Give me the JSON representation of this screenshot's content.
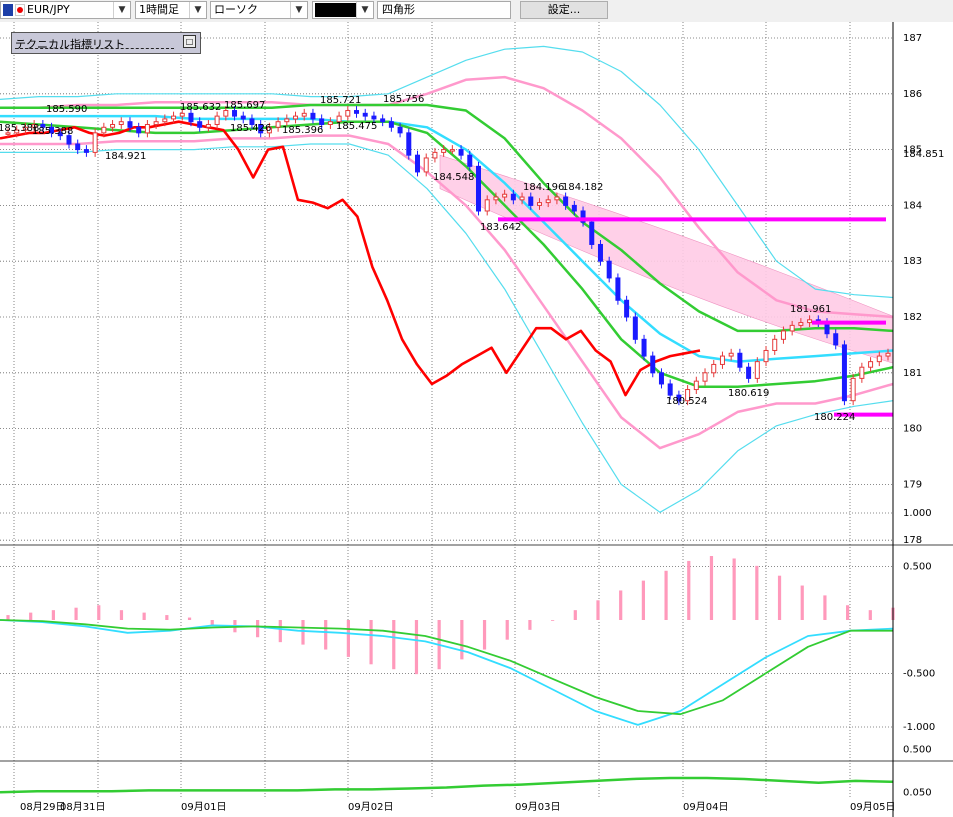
{
  "toolbar": {
    "symbol": "EUR/JPY",
    "timeframe": "1時間足",
    "chart_type": "ローソク",
    "drawing_tool_value": "",
    "shape_label": "四角形",
    "settings_label": "設定..."
  },
  "indicator_panel": {
    "title": "テクニカル指標リスト"
  },
  "colors": {
    "bull": "#e53939",
    "bear": "#1a1aff",
    "rsi": "#ff0000",
    "bb_outer": "#55ddee",
    "bb_inner": "#ff99cc",
    "ma_green": "#33cc33",
    "ma_cyan": "#33ddff",
    "cloud": "#ffcce6",
    "hline": "#ff00ff"
  },
  "chart_data": [
    {
      "type": "line",
      "name": "price",
      "y_ticks": [
        "187",
        "186",
        "185",
        "184",
        "183",
        "182",
        "181",
        "180",
        "179",
        "178"
      ],
      "ylim": [
        177.8,
        187.3
      ],
      "current_price": "184.851",
      "x_date_labels": [
        "08月29日",
        "08月31日",
        "09月01日",
        "09月02日",
        "09月03日",
        "09月04日",
        "09月05日"
      ],
      "annotations": [
        "185.388",
        "185.590",
        "184.921",
        "185.632",
        "185.697",
        "185.426",
        "185.396",
        "185.721",
        "185.475",
        "185.756",
        "184.548",
        "184.196",
        "184.182",
        "183.642",
        "180.524",
        "180.619",
        "181.961",
        "180.224"
      ],
      "candles_close": [
        185.3,
        185.35,
        185.4,
        185.45,
        185.4,
        185.3,
        185.25,
        185.1,
        185.0,
        184.95,
        185.3,
        185.4,
        185.45,
        185.5,
        185.4,
        185.3,
        185.45,
        185.5,
        185.55,
        185.6,
        185.65,
        185.5,
        185.4,
        185.45,
        185.6,
        185.7,
        185.6,
        185.55,
        185.45,
        185.3,
        185.4,
        185.5,
        185.55,
        185.6,
        185.65,
        185.55,
        185.45,
        185.5,
        185.6,
        185.7,
        185.65,
        185.6,
        185.55,
        185.5,
        185.4,
        185.3,
        184.9,
        184.6,
        184.85,
        184.95,
        185.0,
        185.0,
        184.9,
        184.7,
        183.9,
        184.1,
        184.15,
        184.2,
        184.1,
        184.15,
        184.0,
        184.05,
        184.1,
        184.15,
        184.0,
        183.9,
        183.7,
        183.3,
        183.0,
        182.7,
        182.3,
        182.0,
        181.6,
        181.3,
        181.0,
        180.8,
        180.6,
        180.5,
        180.7,
        180.85,
        181.0,
        181.15,
        181.3,
        181.35,
        181.1,
        180.9,
        181.2,
        181.4,
        181.6,
        181.75,
        181.85,
        181.9,
        181.95,
        181.9,
        181.7,
        181.5,
        180.5,
        180.9,
        181.1,
        181.2,
        181.3,
        181.35
      ],
      "bb_upper2": [
        185.9,
        185.95,
        185.95,
        186.0,
        186.0,
        186.0,
        186.0,
        186.0,
        185.95,
        185.95,
        186.0,
        186.3,
        186.6,
        186.8,
        186.85,
        186.75,
        186.4,
        185.8,
        185.0,
        184.0,
        183.0,
        182.5,
        182.4,
        182.35
      ],
      "bb_upper1": [
        185.75,
        185.75,
        185.8,
        185.8,
        185.85,
        185.85,
        185.85,
        185.85,
        185.8,
        185.8,
        185.8,
        186.0,
        186.25,
        186.3,
        186.1,
        185.7,
        185.2,
        184.5,
        183.6,
        182.8,
        182.3,
        182.1,
        182.05,
        182.0
      ],
      "bb_lower1": [
        185.1,
        185.1,
        185.1,
        185.15,
        185.15,
        185.15,
        185.2,
        185.2,
        185.25,
        185.25,
        185.1,
        184.6,
        184.0,
        183.2,
        182.2,
        181.2,
        180.2,
        179.65,
        179.9,
        180.3,
        180.45,
        180.45,
        180.6,
        180.8
      ],
      "bb_lower2": [
        184.95,
        184.95,
        184.95,
        185.0,
        185.0,
        185.0,
        185.05,
        185.05,
        185.1,
        185.1,
        184.9,
        184.3,
        183.5,
        182.5,
        181.3,
        180.1,
        179.0,
        178.5,
        178.9,
        179.6,
        180.05,
        180.25,
        180.4,
        180.5
      ],
      "ma_green_a": [
        185.75,
        185.75,
        185.75,
        185.75,
        185.75,
        185.75,
        185.75,
        185.75,
        185.8,
        185.8,
        185.8,
        185.8,
        185.7,
        185.2,
        184.4,
        183.7,
        183.2,
        182.6,
        182.1,
        181.75,
        181.75,
        181.8,
        181.8,
        181.75
      ],
      "ma_green_b": [
        185.5,
        185.45,
        185.4,
        185.35,
        185.3,
        185.3,
        185.35,
        185.4,
        185.45,
        185.5,
        185.5,
        185.3,
        184.7,
        184.0,
        183.3,
        182.5,
        181.6,
        181.0,
        180.75,
        180.75,
        180.8,
        180.85,
        180.95,
        181.1
      ],
      "ma_cyan": [
        185.6,
        185.6,
        185.6,
        185.6,
        185.6,
        185.55,
        185.55,
        185.55,
        185.55,
        185.5,
        185.5,
        185.4,
        185.0,
        184.4,
        183.7,
        183.0,
        182.3,
        181.7,
        181.3,
        181.2,
        181.25,
        181.3,
        181.35,
        181.4
      ],
      "rsi_overlay": [
        185.2,
        185.25,
        185.3,
        185.3,
        185.35,
        185.4,
        185.3,
        185.25,
        185.3,
        185.4,
        185.4,
        185.45,
        185.5,
        185.45,
        185.4,
        185.35,
        185.0,
        184.5,
        185.0,
        185.05,
        184.1,
        184.05,
        183.95,
        184.1,
        183.8,
        182.9,
        182.3,
        181.6,
        181.15,
        180.8,
        180.95,
        181.15,
        181.3,
        181.45,
        181.0,
        181.4,
        181.8,
        181.8,
        181.6,
        181.75,
        181.4,
        181.2,
        180.6,
        181.05,
        181.2,
        181.3,
        181.35,
        181.4
      ]
    },
    {
      "type": "line",
      "name": "macd",
      "y_ticks": [
        "1.000",
        "0.500",
        "-0.500",
        "-1.000"
      ],
      "ylim": [
        -1.1,
        1.1
      ],
      "histogram": [
        0.02,
        0.03,
        0.04,
        0.05,
        0.06,
        0.04,
        0.03,
        0.02,
        0.01,
        -0.02,
        -0.05,
        -0.07,
        -0.09,
        -0.1,
        -0.12,
        -0.15,
        -0.18,
        -0.2,
        -0.22,
        -0.2,
        -0.16,
        -0.12,
        -0.08,
        -0.04,
        0.0,
        0.04,
        0.08,
        0.12,
        0.16,
        0.2,
        0.24,
        0.26,
        0.25,
        0.22,
        0.18,
        0.14,
        0.1,
        0.06,
        0.04,
        0.05
      ],
      "macd_line": [
        0.0,
        -0.02,
        -0.06,
        -0.12,
        -0.1,
        -0.05,
        -0.06,
        -0.1,
        -0.12,
        -0.15,
        -0.2,
        -0.3,
        -0.45,
        -0.65,
        -0.85,
        -0.98,
        -0.85,
        -0.6,
        -0.35,
        -0.15,
        -0.1,
        -0.08
      ],
      "signal_line": [
        0.0,
        -0.01,
        -0.04,
        -0.08,
        -0.09,
        -0.07,
        -0.06,
        -0.07,
        -0.08,
        -0.1,
        -0.15,
        -0.25,
        -0.38,
        -0.55,
        -0.72,
        -0.85,
        -0.88,
        -0.75,
        -0.5,
        -0.25,
        -0.1,
        -0.1
      ]
    },
    {
      "type": "line",
      "name": "volatility",
      "y_ticks": [
        "0.500",
        "0.050"
      ],
      "ylim": [
        0.0,
        0.55
      ],
      "values": [
        0.05,
        0.06,
        0.06,
        0.06,
        0.07,
        0.07,
        0.07,
        0.07,
        0.07,
        0.08,
        0.08,
        0.09,
        0.1,
        0.12,
        0.13,
        0.15,
        0.17,
        0.19,
        0.2,
        0.2,
        0.19,
        0.17,
        0.15,
        0.17,
        0.16
      ]
    }
  ]
}
